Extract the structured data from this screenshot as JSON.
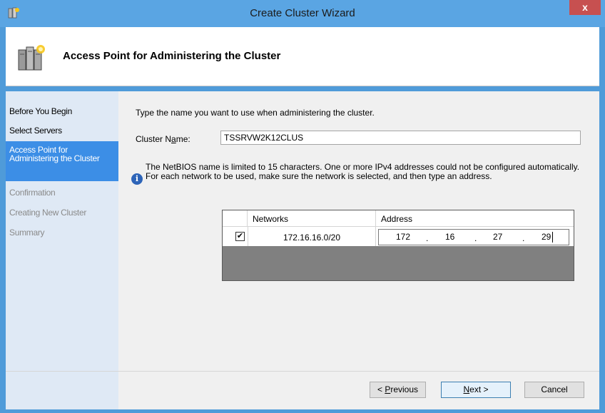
{
  "window": {
    "title": "Create Cluster Wizard",
    "close_glyph": "x"
  },
  "header": {
    "title": "Access Point for Administering the Cluster"
  },
  "nav": {
    "items": [
      {
        "label": "Before You Begin",
        "state": "normal"
      },
      {
        "label": "Select Servers",
        "state": "normal"
      },
      {
        "label": "Access Point for Administering the Cluster",
        "state": "active"
      },
      {
        "label": "Confirmation",
        "state": "disabled"
      },
      {
        "label": "Creating New Cluster",
        "state": "disabled"
      },
      {
        "label": "Summary",
        "state": "disabled"
      }
    ]
  },
  "main": {
    "instruction": "Type the name you want to use when administering the cluster.",
    "cluster_name_label_pre": "Cluster N",
    "cluster_name_label_key": "a",
    "cluster_name_label_post": "me:",
    "cluster_name_value": "TSSRVW2K12CLUS",
    "info_text": "The NetBIOS name is limited to 15 characters.  One or more IPv4 addresses could not be configured automatically.  For each network to be used, make sure the network is selected, and then type an address.",
    "grid": {
      "columns": [
        "Networks",
        "Address"
      ],
      "rows": [
        {
          "checked": "✔",
          "network": "172.16.16.0/20",
          "ip": [
            "172",
            "16",
            "27",
            "29"
          ]
        }
      ]
    }
  },
  "footer": {
    "previous_pre": "< ",
    "previous_key": "P",
    "previous_post": "revious",
    "next_key": "N",
    "next_post": "ext >",
    "cancel": "Cancel"
  },
  "colors": {
    "frame": "#4f9bd9",
    "titlebar": "#5aa5e3",
    "close": "#c75050",
    "nav_bg": "#dfe9f5",
    "nav_active": "#3c8ee6"
  }
}
